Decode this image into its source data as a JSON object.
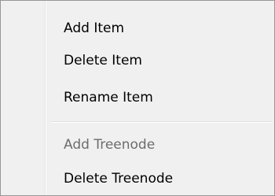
{
  "context_menu": {
    "items": [
      {
        "label": "Add Item",
        "enabled": true
      },
      {
        "label": "Delete Item",
        "enabled": true
      },
      {
        "label": "Rename Item",
        "enabled": true
      },
      {
        "label": "Add Treenode",
        "enabled": false
      },
      {
        "label": "Delete Treenode",
        "enabled": true
      }
    ]
  }
}
